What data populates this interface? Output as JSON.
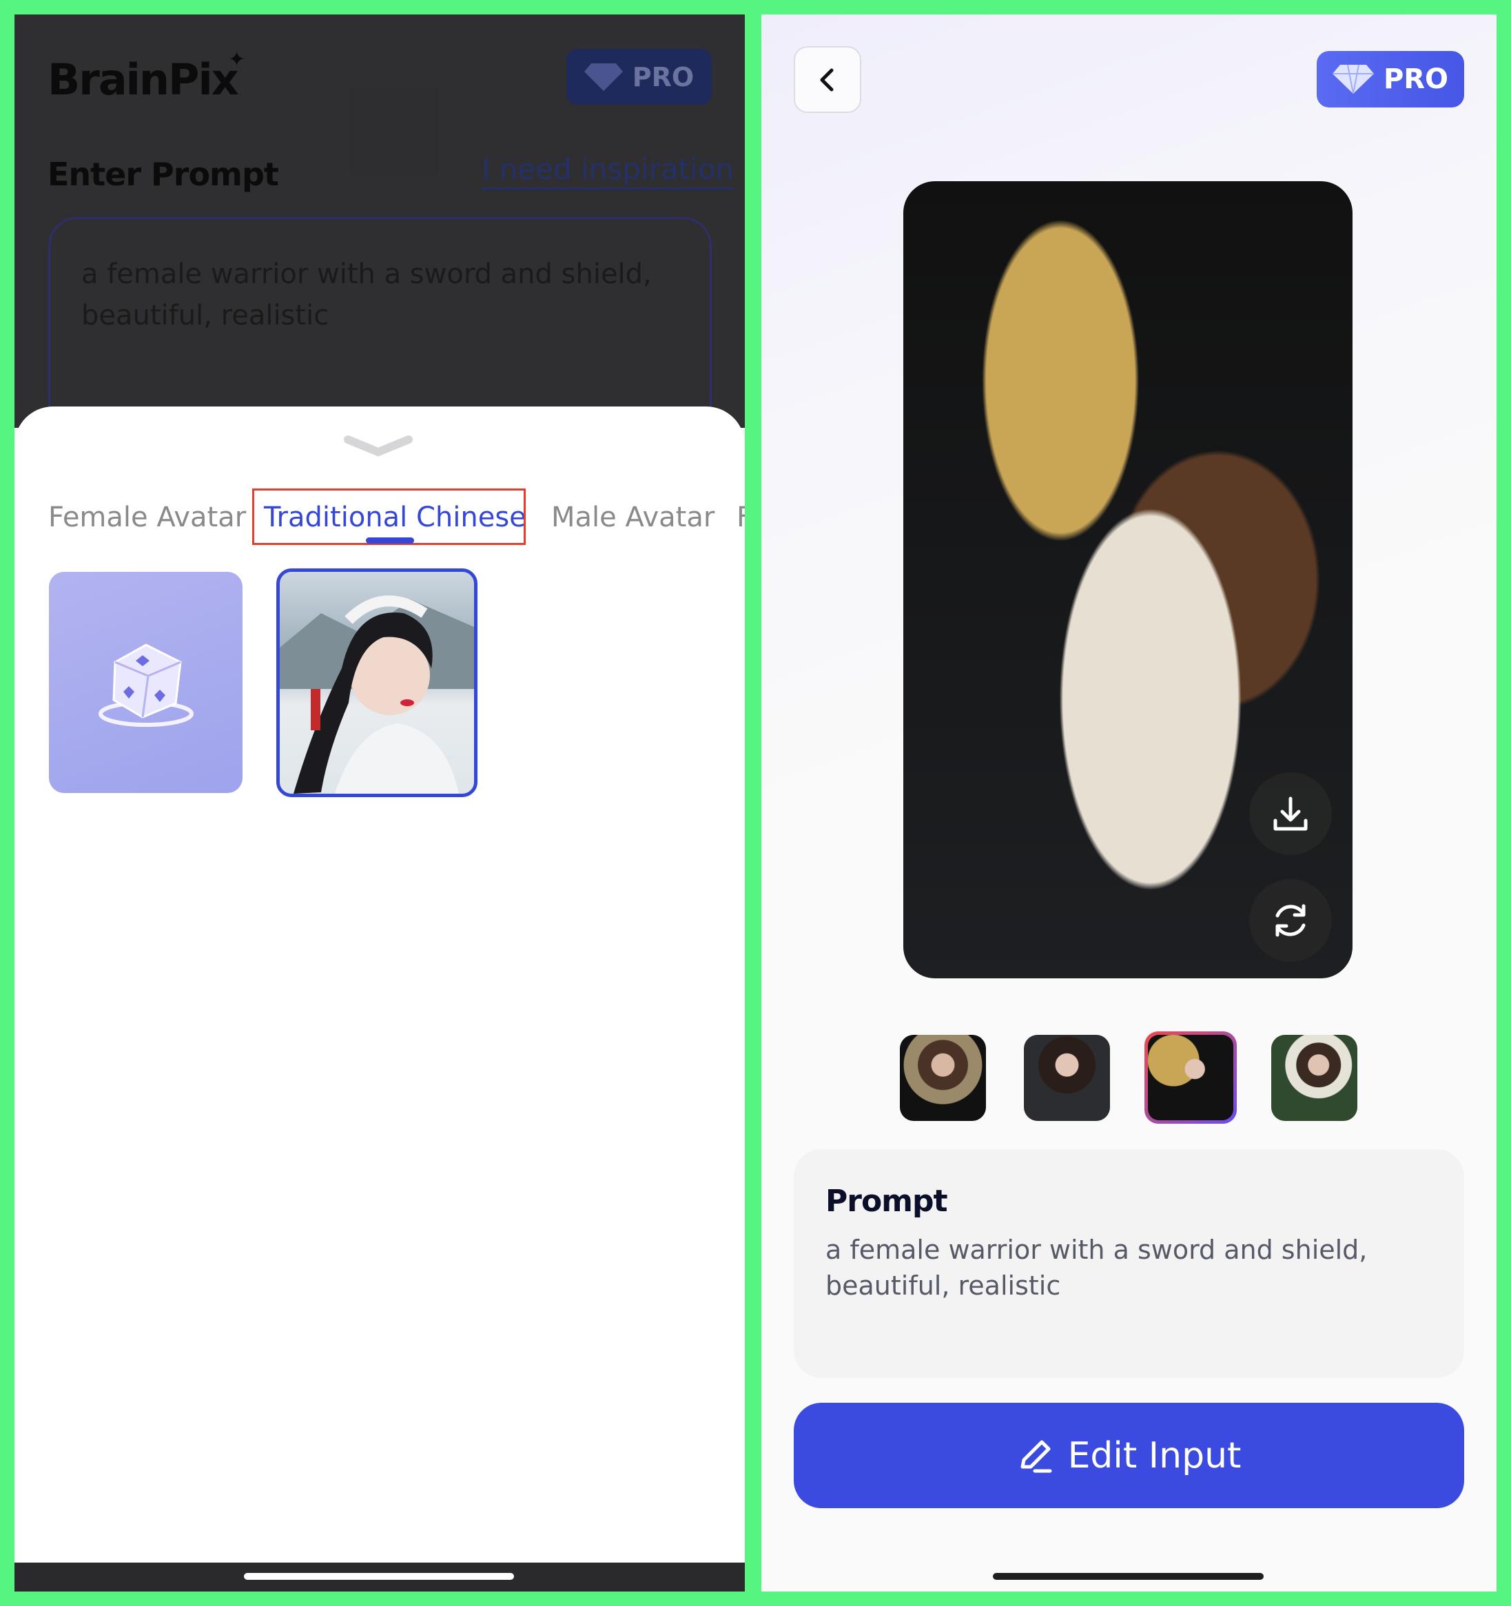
{
  "left": {
    "logo": "BrainPix",
    "pro_label": "PRO",
    "enter_prompt_label": "Enter Prompt",
    "inspiration_link": "I need inspiration",
    "prompt_value": "a female warrior with a sword and shield, beautiful, realistic",
    "tabs": [
      {
        "label": "Female Avatar",
        "active": false
      },
      {
        "label": "Traditional Chinese",
        "active": true
      },
      {
        "label": "Male Avatar",
        "active": false
      },
      {
        "label": "F",
        "active": false
      }
    ],
    "style_cards": [
      {
        "name": "random-dice",
        "selected": false
      },
      {
        "name": "traditional-chinese-portrait",
        "selected": true
      }
    ]
  },
  "right": {
    "pro_label": "PRO",
    "thumbnails": [
      {
        "selected": false
      },
      {
        "selected": false
      },
      {
        "selected": true
      },
      {
        "selected": false
      }
    ],
    "prompt_title": "Prompt",
    "prompt_text": "a female warrior with a sword and shield, beautiful, realistic",
    "edit_button": "Edit Input"
  },
  "colors": {
    "accent": "#3c4bdf",
    "tab_active": "#3447d6",
    "highlight_box": "#e53c2e",
    "frame": "#55f57f"
  },
  "icons": [
    "diamond-icon",
    "chevron-down-icon",
    "dice-icon",
    "back-arrow-icon",
    "download-icon",
    "refresh-icon",
    "pencil-icon"
  ]
}
